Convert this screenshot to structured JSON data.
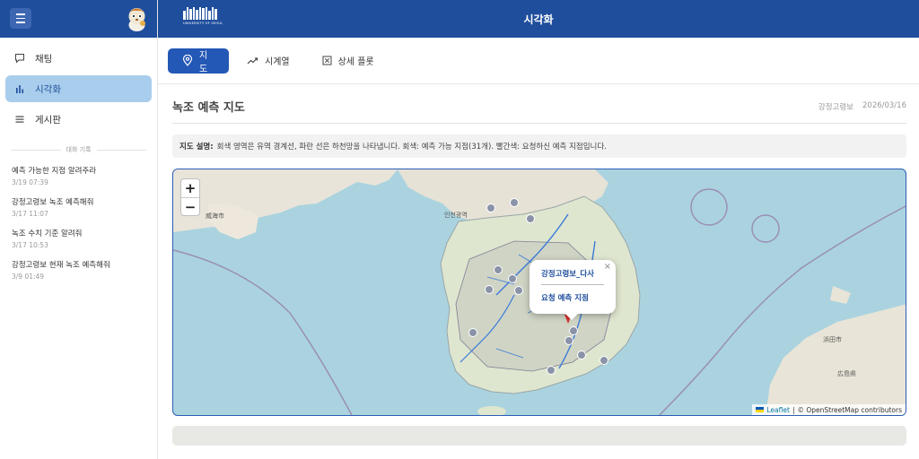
{
  "sidebar": {
    "nav": [
      {
        "label": "채팅",
        "icon": "chat-icon"
      },
      {
        "label": "시각화",
        "icon": "bar-chart-icon",
        "active": true
      },
      {
        "label": "게시판",
        "icon": "list-icon"
      }
    ],
    "history_title": "대화 기록",
    "history": [
      {
        "title": "예측 가능한 지점 알려주라",
        "time": "3/19 07:39"
      },
      {
        "title": "강정고령보 녹조 예측해줘",
        "time": "3/17 11:07"
      },
      {
        "title": "녹조 수치 기준 알려줘",
        "time": "3/17 10:53"
      },
      {
        "title": "강정고령보 현재 녹조 예측해줘",
        "time": "3/9 01:49"
      }
    ]
  },
  "header": {
    "title": "시각화",
    "logo_text": "UNIVERSITY OF SEOUL"
  },
  "tabs": [
    {
      "label": "지도",
      "icon": "map-pin-icon",
      "active": true
    },
    {
      "label": "시계열",
      "icon": "trend-icon"
    },
    {
      "label": "상세 플롯",
      "icon": "plot-icon"
    }
  ],
  "panel": {
    "title": "녹조 예측 지도",
    "site": "강정고령보",
    "date": "2026/03/16",
    "desc_label": "지도 설명:",
    "desc_text": "회색 영역은 유역 경계선, 파란 선은 하천망을 나타냅니다. 회색: 예측 가능 지점(31개). 빨간색: 요청하신 예측 지점입니다."
  },
  "map": {
    "zoom_in": "+",
    "zoom_out": "−",
    "popup": {
      "name": "강정고령보_다사",
      "subtitle": "요청 예측 지점",
      "close": "×"
    },
    "attribution": {
      "leaflet": "Leaflet",
      "osm": "© OpenStreetMap contributors",
      "sep": "|"
    },
    "marker_colors": {
      "available": "#8a93a8",
      "requested": "#d0312d"
    }
  },
  "colors": {
    "primary": "#1f4e9c",
    "active_nav": "#a9cdec",
    "tab_active": "#2458b6"
  }
}
